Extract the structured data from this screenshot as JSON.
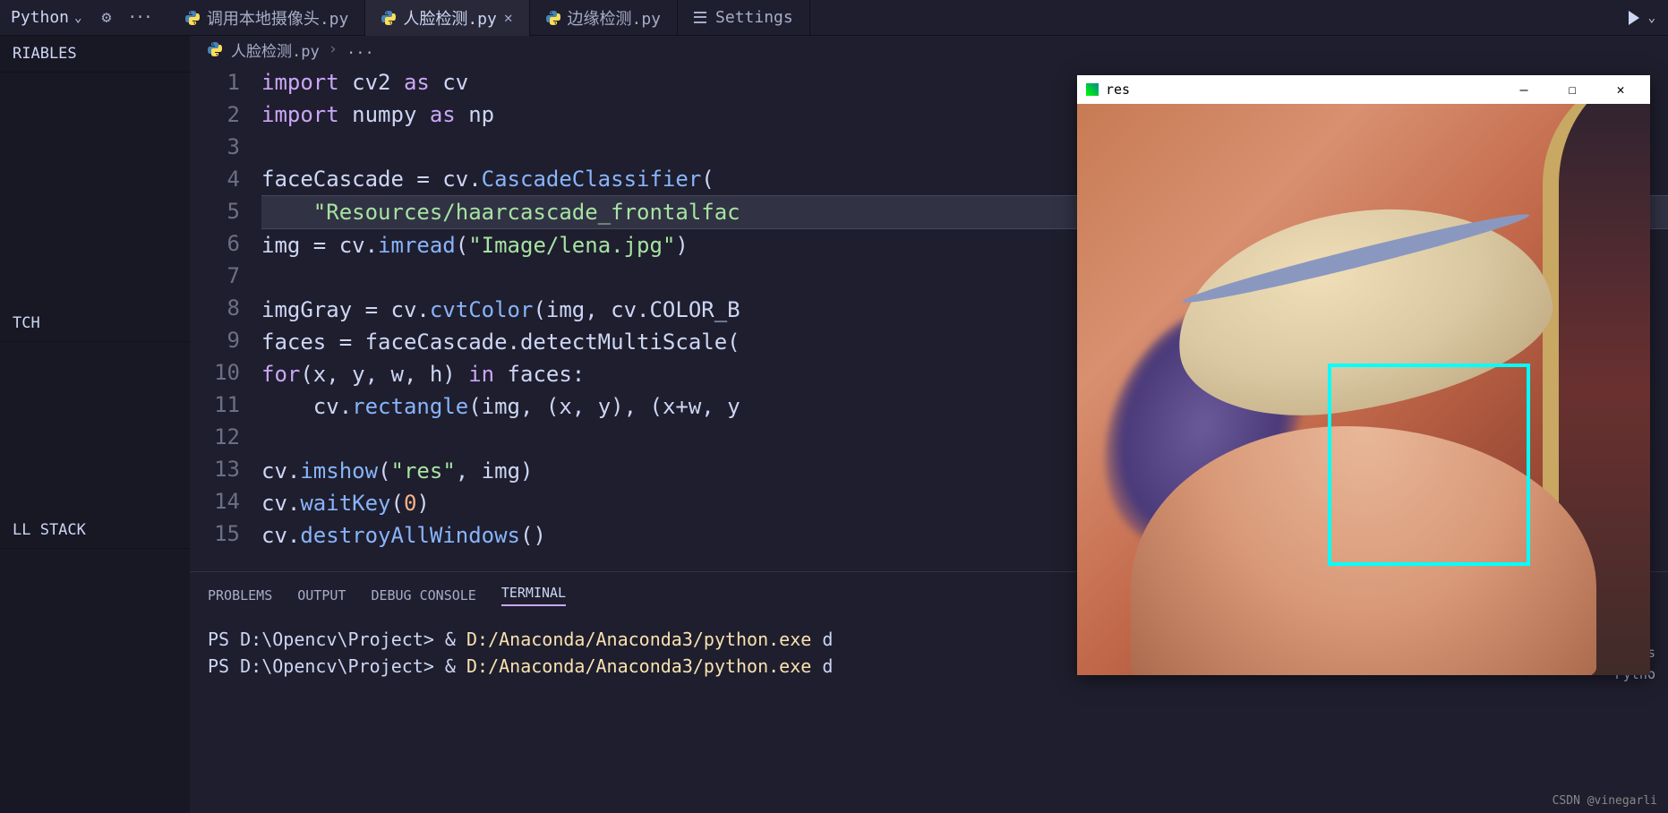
{
  "topbar": {
    "language": "Python"
  },
  "tabs": [
    {
      "label": "调用本地摄像头.py"
    },
    {
      "label": "人脸检测.py",
      "active": true
    },
    {
      "label": "边缘检测.py"
    },
    {
      "label": "Settings",
      "settings": true
    }
  ],
  "breadcrumb": {
    "file": "人脸检测.py",
    "sep": "›",
    "more": "..."
  },
  "sidebar": {
    "variables_label": "RIABLES",
    "watch_label": "TCH",
    "callstack_label": "LL STACK"
  },
  "code": {
    "lines": [
      "1",
      "2",
      "3",
      "4",
      "5",
      "6",
      "7",
      "8",
      "9",
      "10",
      "11",
      "12",
      "13",
      "14",
      "15"
    ],
    "l1_import": "import",
    "l1_cv2": " cv2 ",
    "l1_as": "as",
    "l1_cv": " cv",
    "l2_import": "import",
    "l2_numpy": " numpy ",
    "l2_as": "as",
    "l2_np": " np",
    "l4_a": "faceCascade = cv.",
    "l4_fn": "CascadeClassifier",
    "l4_b": "(",
    "l5_str": "\"Resources/haarcascade_frontalfac",
    "l6_a": "img = cv.",
    "l6_fn": "imread",
    "l6_b": "(",
    "l6_str": "\"Image/lena.jpg\"",
    "l6_c": ")",
    "l8_a": "imgGray = cv.",
    "l8_fn": "cvtColor",
    "l8_b": "(img, cv.COLOR_B",
    "l9": "faces = faceCascade.detectMultiScale(",
    "l10_for": "for",
    "l10_a": "(x, y, w, h) ",
    "l10_in": "in",
    "l10_b": " faces:",
    "l11_a": "    cv.",
    "l11_fn": "rectangle",
    "l11_b": "(img, (x, y), (x+w, y",
    "l13_a": "cv.",
    "l13_fn": "imshow",
    "l13_b": "(",
    "l13_str": "\"res\"",
    "l13_c": ", img)",
    "l14_a": "cv.",
    "l14_fn": "waitKey",
    "l14_b": "(",
    "l14_num": "0",
    "l14_c": ")",
    "l15_a": "cv.",
    "l15_fn": "destroyAllWindows",
    "l15_b": "()"
  },
  "panel": {
    "problems": "PROBLEMS",
    "output": "OUTPUT",
    "debug": "DEBUG CONSOLE",
    "terminal": "TERMINAL"
  },
  "terminal_lines": [
    {
      "prompt": "PS D:\\Opencv\\Project> ",
      "amp": "&",
      "cmd": " D:/Anaconda/Anaconda3/python.exe",
      "rest": " d"
    },
    {
      "prompt": "PS D:\\Opencv\\Project> ",
      "amp": "&",
      "cmd": " D:/Anaconda/Anaconda3/python.exe",
      "rest": " d"
    }
  ],
  "res_window": {
    "title": "res"
  },
  "right_pills": {
    "a": "powers",
    "b": "Pytho"
  },
  "watermark": "CSDN @vinegarli"
}
